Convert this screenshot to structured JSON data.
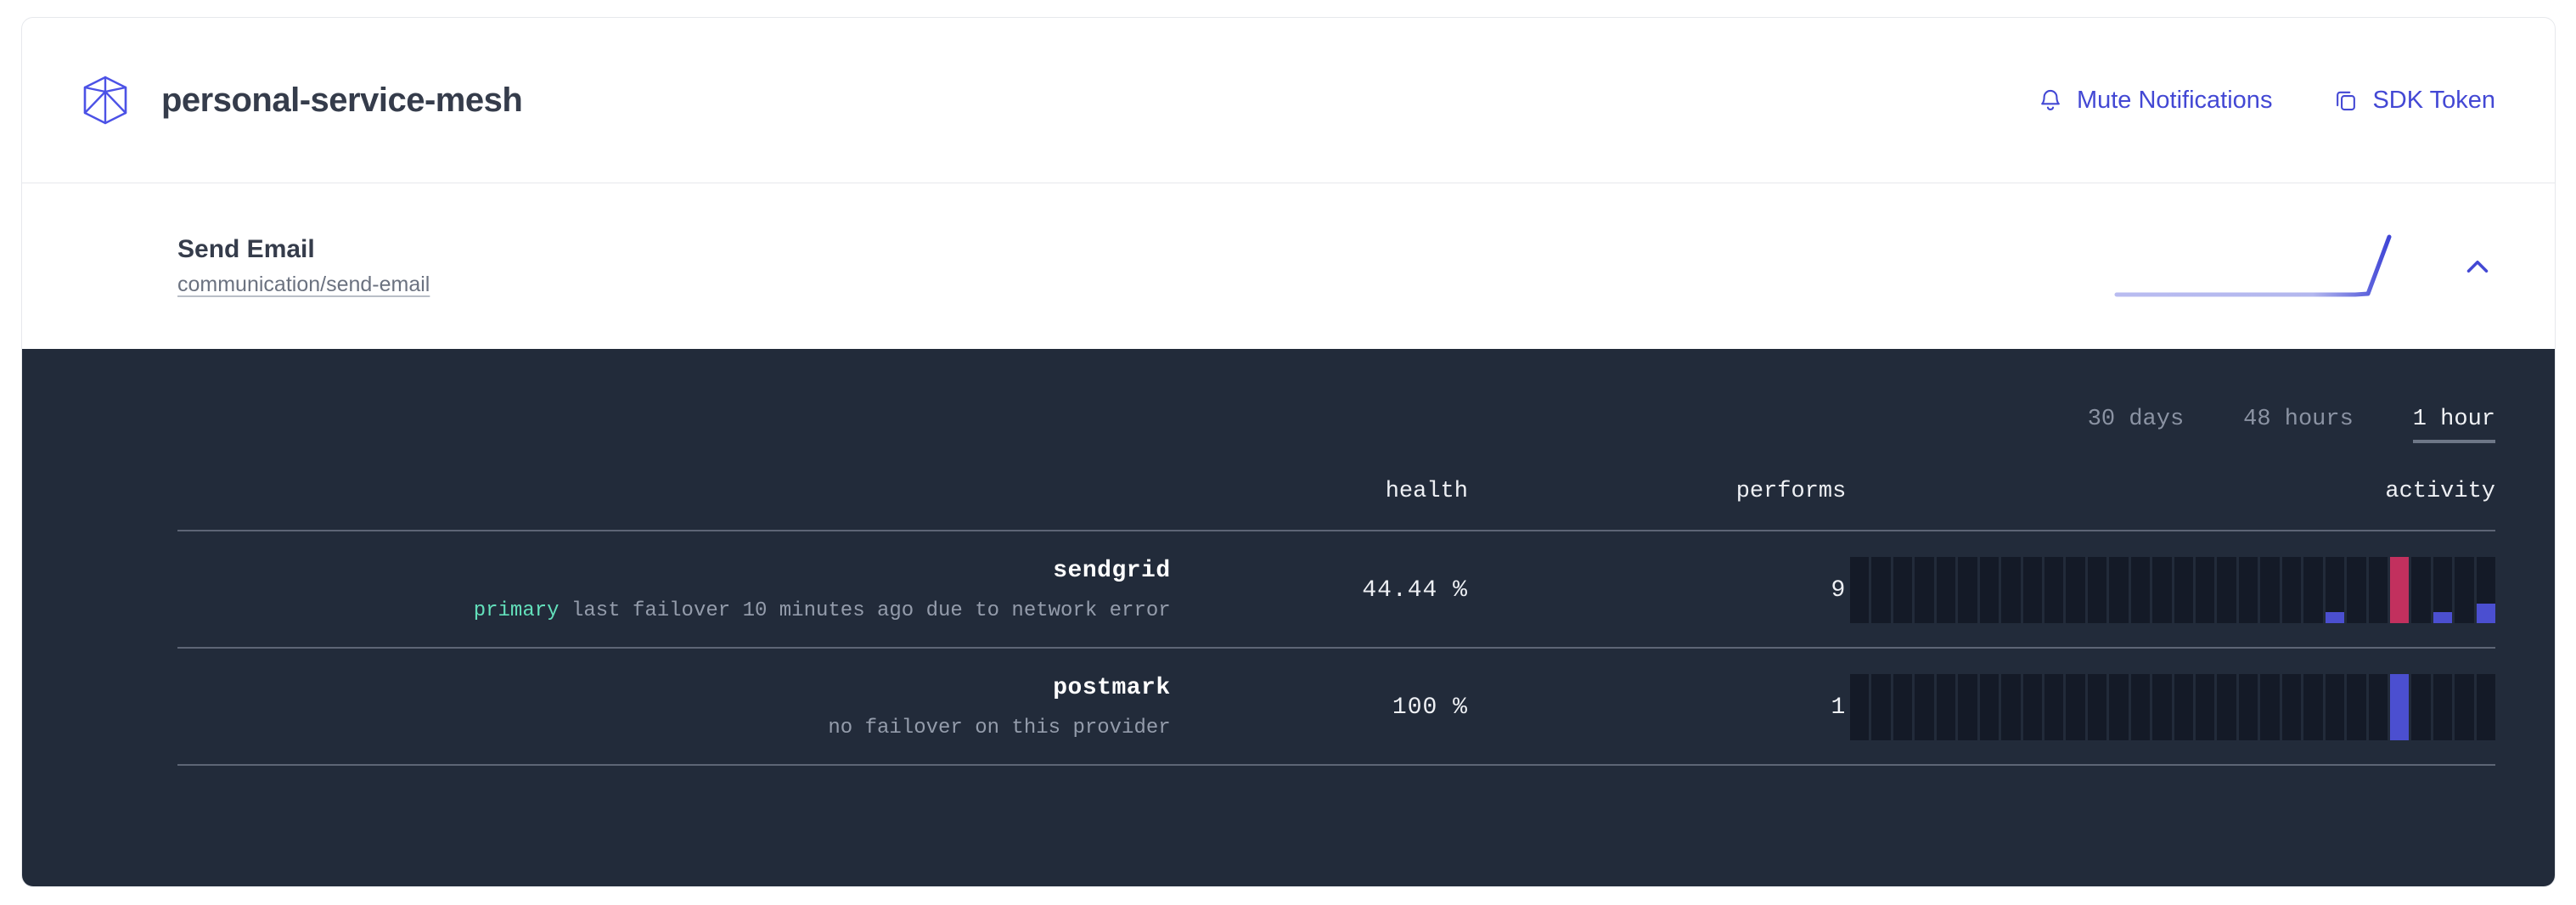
{
  "header": {
    "logo_icon": "cube-icon",
    "title": "personal-service-mesh",
    "actions": [
      {
        "icon": "bell-icon",
        "label": "Mute Notifications"
      },
      {
        "icon": "copy-icon",
        "label": "SDK Token"
      }
    ]
  },
  "service": {
    "title": "Send Email",
    "path": "communication/send-email",
    "sparkline_icon": "sparkline-trend",
    "collapse_icon": "chevron-up-icon"
  },
  "time_ranges": [
    {
      "label": "30 days",
      "active": false
    },
    {
      "label": "48 hours",
      "active": false
    },
    {
      "label": "1 hour",
      "active": true
    }
  ],
  "table": {
    "columns": [
      "",
      "health",
      "performs",
      "activity"
    ],
    "rows": [
      {
        "name": "sendgrid",
        "tag": "primary",
        "note": "last failover 10 minutes ago due to network error",
        "health": "44.44 %",
        "performs": "9"
      },
      {
        "name": "postmark",
        "tag": "",
        "note": "no failover on this provider",
        "health": "100 %",
        "performs": "1"
      }
    ]
  },
  "colors": {
    "accent": "#4348d4",
    "panel_bg": "#222b3a",
    "bar_empty": "#141a27",
    "bar_ok": "#4b4fd0",
    "bar_error": "#c2305e",
    "tag_primary": "#63e0bb",
    "title": "#353c4b"
  },
  "chart_data": [
    {
      "type": "bar",
      "title": "sendgrid activity",
      "xlabel": "",
      "ylabel": "",
      "ylim": [
        0,
        1
      ],
      "bars": 30,
      "values": [
        0,
        0,
        0,
        0,
        0,
        0,
        0,
        0,
        0,
        0,
        0,
        0,
        0,
        0,
        0,
        0,
        0,
        0,
        0,
        0,
        0,
        0,
        0.17,
        0,
        0,
        1.0,
        0,
        0.17,
        0,
        0.3
      ],
      "bar_colors": [
        "empty",
        "empty",
        "empty",
        "empty",
        "empty",
        "empty",
        "empty",
        "empty",
        "empty",
        "empty",
        "empty",
        "empty",
        "empty",
        "empty",
        "empty",
        "empty",
        "empty",
        "empty",
        "empty",
        "empty",
        "empty",
        "empty",
        "ok",
        "empty",
        "empty",
        "error",
        "empty",
        "ok",
        "empty",
        "ok"
      ]
    },
    {
      "type": "bar",
      "title": "postmark activity",
      "xlabel": "",
      "ylabel": "",
      "ylim": [
        0,
        1
      ],
      "bars": 30,
      "values": [
        0,
        0,
        0,
        0,
        0,
        0,
        0,
        0,
        0,
        0,
        0,
        0,
        0,
        0,
        0,
        0,
        0,
        0,
        0,
        0,
        0,
        0,
        0,
        0,
        0,
        1.0,
        0,
        0,
        0,
        0
      ],
      "bar_colors": [
        "empty",
        "empty",
        "empty",
        "empty",
        "empty",
        "empty",
        "empty",
        "empty",
        "empty",
        "empty",
        "empty",
        "empty",
        "empty",
        "empty",
        "empty",
        "empty",
        "empty",
        "empty",
        "empty",
        "empty",
        "empty",
        "empty",
        "empty",
        "empty",
        "empty",
        "ok",
        "empty",
        "empty",
        "empty",
        "empty"
      ]
    }
  ]
}
